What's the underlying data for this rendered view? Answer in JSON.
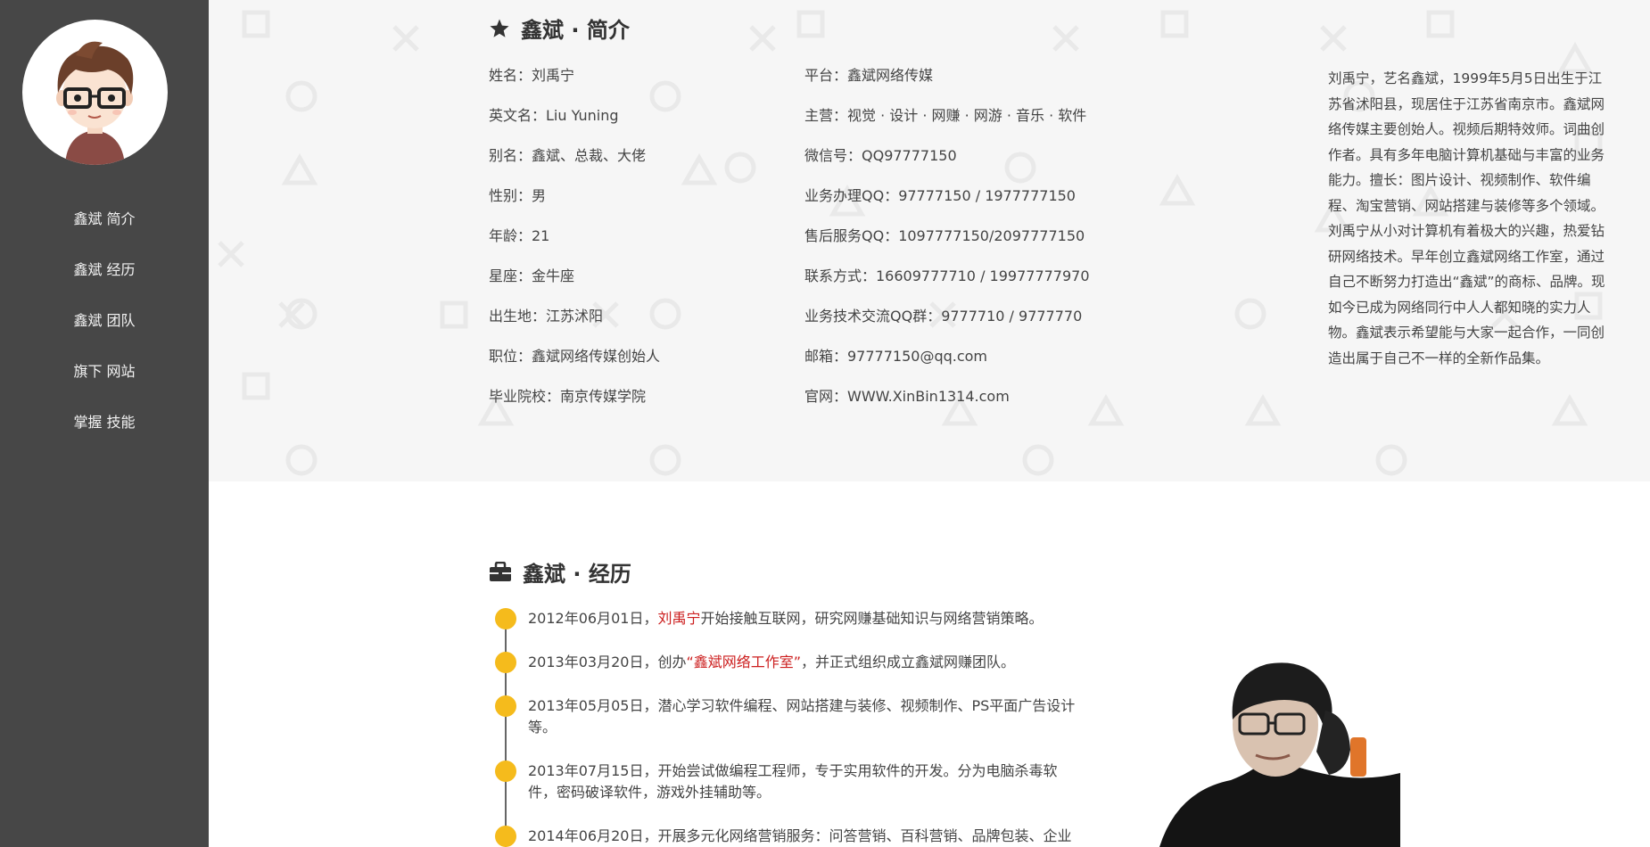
{
  "sidebar": {
    "nav": [
      {
        "label": "鑫斌 简介"
      },
      {
        "label": "鑫斌 经历"
      },
      {
        "label": "鑫斌 团队"
      },
      {
        "label": "旗下 网站"
      },
      {
        "label": "掌握 技能"
      }
    ]
  },
  "intro": {
    "title": "鑫斌 · 简介",
    "col1": [
      "姓名：刘禹宁",
      "英文名：Liu Yuning",
      "别名：鑫斌、总裁、大佬",
      "性别：男",
      "年龄：21",
      "星座：金牛座",
      "出生地：江苏沭阳",
      "职位：鑫斌网络传媒创始人",
      "毕业院校：南京传媒学院"
    ],
    "col2": [
      "平台：鑫斌网络传媒",
      "主营：视觉 · 设计 · 网赚 · 网游 · 音乐 · 软件",
      "微信号：QQ97777150",
      "业务办理QQ：97777150 / 1977777150",
      "售后服务QQ：1097777150/2097777150",
      "联系方式：16609777710 / 19977777970",
      "业务技术交流QQ群：9777710 / 9777770",
      "邮箱：97777150@qq.com",
      "官网：WWW.XinBin1314.com"
    ],
    "bio": "刘禹宁，艺名鑫斌，1999年5月5日出生于江苏省沭阳县，现居住于江苏省南京市。鑫斌网络传媒主要创始人。视频后期特效师。词曲创作者。具有多年电脑计算机基础与丰富的业务能力。擅长：图片设计、视频制作、软件编程、淘宝营销、网站搭建与装修等多个领域。刘禹宁从小对计算机有着极大的兴趣，热爱钻研网络技术。早年创立鑫斌网络工作室，通过自己不断努力打造出“鑫斌”的商标、品牌。现如今已成为网络同行中人人都知晓的实力人物。鑫斌表示希望能与大家一起合作，一同创造出属于自己不一样的全新作品集。"
  },
  "experience": {
    "title": "鑫斌 · 经历",
    "items": [
      {
        "a": "2012年06月01日，",
        "b": "刘禹宁",
        "c": "开始接触互联网，研究网赚基础知识与网络营销策略。"
      },
      {
        "a": "2013年03月20日，创办",
        "b": "“鑫斌网络工作室”",
        "c": "，并正式组织成立鑫斌网赚团队。"
      },
      {
        "a": "2013年05月05日，潜心学习软件编程、网站搭建与装修、视频制作、PS平面广告设计等。",
        "b": "",
        "c": ""
      },
      {
        "a": "2013年07月15日，开始尝试做编程工程师，专于实用软件的开发。分为电脑杀毒软件，密码破译软件，游戏外挂辅助等。",
        "b": "",
        "c": ""
      },
      {
        "a": "2014年06月20日，开展多元化网络营销服务：问答营销、百科营销、品牌包装、企业",
        "b": "",
        "c": ""
      }
    ]
  }
}
